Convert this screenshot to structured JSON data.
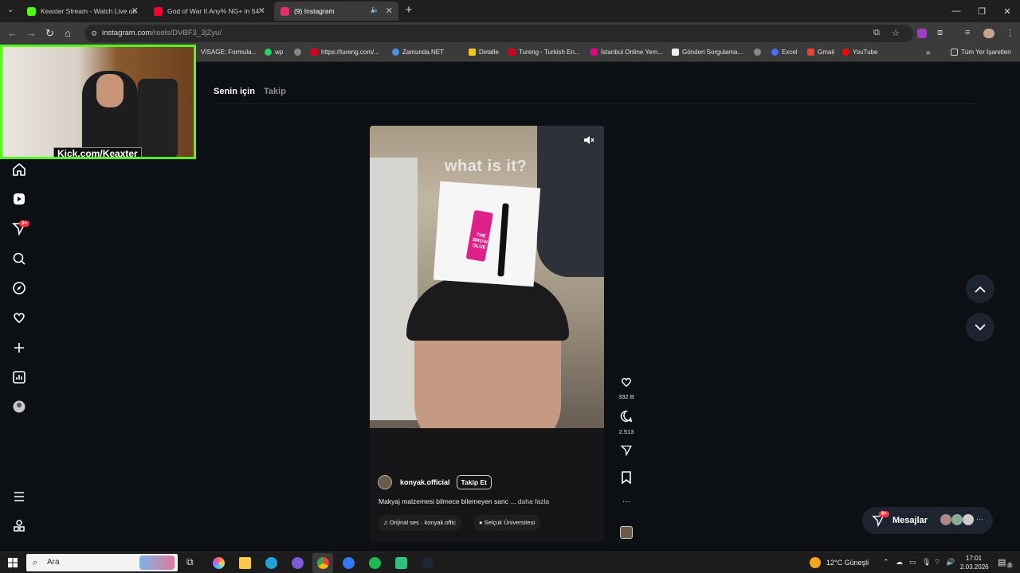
{
  "browser": {
    "tabs": [
      {
        "title": "Keaxter Stream - Watch Live on",
        "icon_color": "#53fc18",
        "active": false
      },
      {
        "title": "God of War II Any% NG+ in 54",
        "icon_color": "#ff0033",
        "active": false
      },
      {
        "title": "(9) Instagram",
        "icon_color": "#e1306c",
        "active": true
      }
    ],
    "url": {
      "host": "instagram.com",
      "path": "/reels/DVBF3_3jZyu/"
    },
    "bookmarks": [
      "VISAGE: Formula...",
      "wp",
      "https://tureng.com/...",
      "Zamunda.NET",
      "Detalle",
      "Tureng - Turkish En...",
      "İstanbul Online Yem...",
      "Gönderi Sorgulama...",
      "Excel",
      "Gmail",
      "YouTube"
    ],
    "all_bookmarks": "Tüm Yer İşaretleri",
    "more_bookmarks": "»"
  },
  "webcam": {
    "label": "Kick.com/Keaxter",
    "border_color": "#53fc18"
  },
  "sidebar": {
    "icons": [
      "home-icon",
      "reels-icon",
      "direct-icon",
      "search-icon",
      "explore-icon",
      "heart-icon",
      "create-icon",
      "dashboard-icon",
      "profile-icon",
      "menu-icon",
      "threads-icon"
    ],
    "direct_badge": "9+"
  },
  "feed_tabs": {
    "for_you": "Senin için",
    "following": "Takip"
  },
  "reel": {
    "headline": "what is it?",
    "sticker_text": "THE BROW GLUE",
    "username": "konyak.official",
    "follow_label": "Takip Et",
    "caption": "Makyaj malzemesi bilmece bilemeyen sanc ...",
    "caption_more": "daha fazla",
    "audio": "Orijinal ses · konyak.offic",
    "location": "Selçuk Üniversitesi"
  },
  "actions": {
    "likes": "332 B",
    "comments": "2.513",
    "more": "···"
  },
  "messages": {
    "label": "Mesajlar",
    "badge": "9+"
  },
  "taskbar": {
    "search_placeholder": "Ara",
    "weather": "12°C  Güneşli",
    "time": "17:01",
    "date": "2.03.2026",
    "notification_count": "3"
  }
}
